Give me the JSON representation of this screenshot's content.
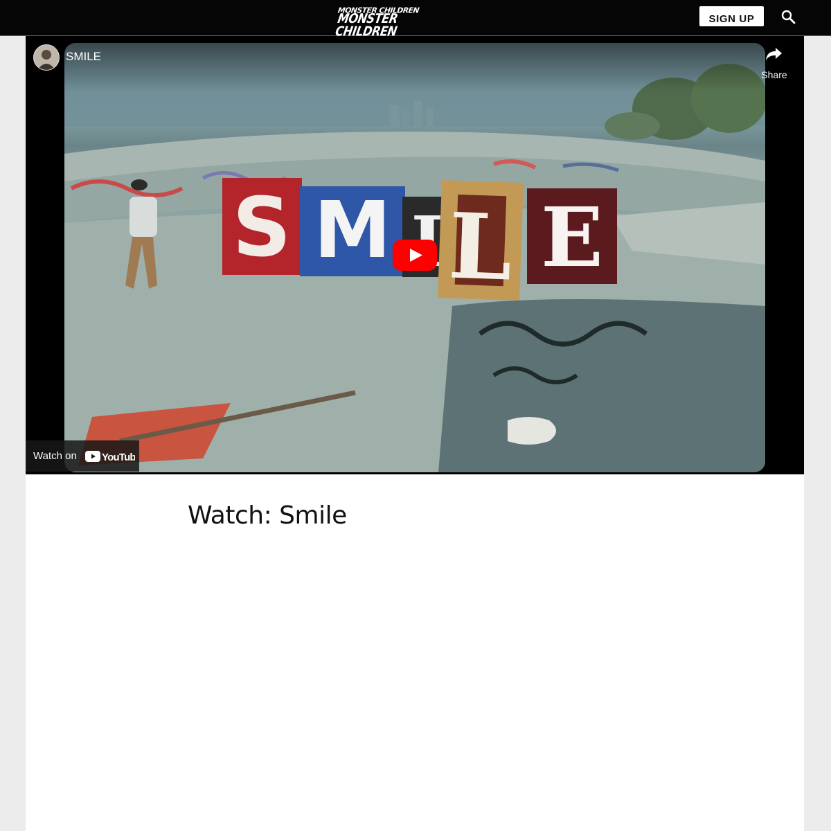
{
  "header": {
    "logo_line1": "MONSTER CHILDREN",
    "logo_line2": "MONSTER CHILDREN",
    "signup_label": "SIGN UP",
    "search_icon": "search-icon"
  },
  "video": {
    "channel_avatar": "avatar",
    "title": "SMILE",
    "share_label": "Share",
    "share_icon": "share-arrow-icon",
    "play_icon": "youtube-play-icon",
    "watch_on_label": "Watch on",
    "brand_logo_text": "YouTube",
    "overlay_letters": [
      "S",
      "M",
      "I",
      "L",
      "E"
    ],
    "brand_color": "#ff0000"
  },
  "article": {
    "title": "Watch: Smile"
  }
}
